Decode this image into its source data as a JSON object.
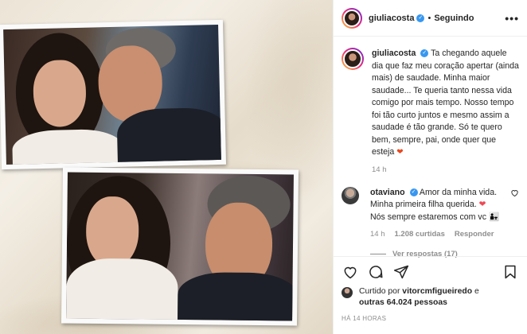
{
  "header": {
    "username": "giuliacosta",
    "separator": "•",
    "follow_status": "Seguindo",
    "more": "•••"
  },
  "caption": {
    "username": "giuliacosta",
    "text": "Ta chegando aquele dia que faz meu coração apertar (ainda mais) de saudade. Minha maior saudade... Te queria tanto nessa vida comigo por mais tempo. Nosso tempo foi tão curto juntos e mesmo assim a saudade é tão grande. Só te quero bem, sempre, pai, onde quer que esteja",
    "emoji": "heart-emoji",
    "time": "14 h"
  },
  "comment": {
    "username": "otaviano",
    "text_line1": "Amor da minha vida.",
    "text_line2": "Minha primeira filha querida.",
    "text_line3": "Nós sempre estaremos com vc",
    "time": "14 h",
    "likes": "1.208 curtidas",
    "reply": "Responder",
    "view_replies": "Ver respostas (17)"
  },
  "likes": {
    "prefix": "Curtido por",
    "user": "vitorcmfigueiredo",
    "connector": "e",
    "others": "outras 64.024 pessoas"
  },
  "timestamp": "HÁ 14 HORAS",
  "icons": [
    "heart-icon",
    "comment-icon",
    "share-icon",
    "bookmark-icon",
    "verified-icon",
    "more-icon"
  ],
  "colors": {
    "verified": "#3897f0",
    "heart": "#ed4956",
    "muted": "#8e8e8e",
    "text": "#262626"
  }
}
